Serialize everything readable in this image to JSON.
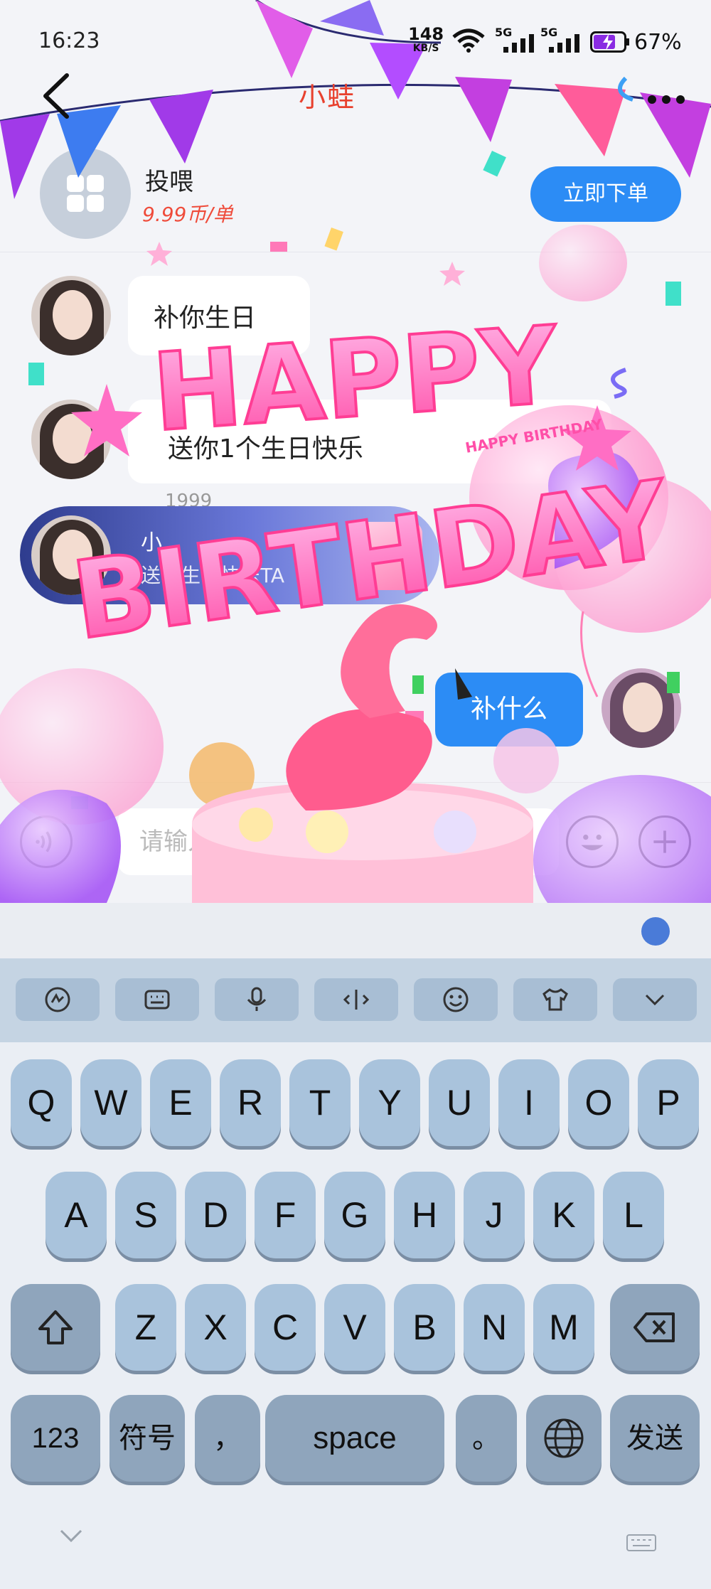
{
  "status_bar": {
    "time": "16:23",
    "net_speed": "148",
    "net_speed_unit": "KB/S",
    "signal_1": "5G",
    "signal_2": "5G",
    "battery": "67%"
  },
  "header": {
    "title": "小蛙",
    "back_icon": "chevron-left-icon",
    "more_icon": "more-dots-icon"
  },
  "service": {
    "name": "投喂",
    "price": "9.99币/单",
    "order_button": "立即下单"
  },
  "messages": [
    {
      "side": "left",
      "text": "补你生日"
    },
    {
      "side": "left",
      "text": "送你1个生日快乐",
      "sub": "1999"
    },
    {
      "side": "left",
      "type": "gift",
      "title": "小",
      "subtitle": "送你生日快乐TA"
    },
    {
      "side": "right",
      "text": "补什么"
    }
  ],
  "overlay": {
    "line1": "HAPPY",
    "line2": "BIRTHDAY",
    "cake_tag": "HAPPY BIRTHDAY"
  },
  "input": {
    "placeholder": "请输入"
  },
  "keyboard": {
    "toolbar": [
      "handwrite-icon",
      "keyboard-icon",
      "microphone-icon",
      "cursor-icon",
      "emoji-icon",
      "shirt-icon",
      "collapse-icon"
    ],
    "row1": [
      "Q",
      "W",
      "E",
      "R",
      "T",
      "Y",
      "U",
      "I",
      "O",
      "P"
    ],
    "row2": [
      "A",
      "S",
      "D",
      "F",
      "G",
      "H",
      "J",
      "K",
      "L"
    ],
    "row3": [
      "Z",
      "X",
      "C",
      "V",
      "B",
      "N",
      "M"
    ],
    "row4": {
      "num": "123",
      "symbols": "符号",
      "comma": "，",
      "space": "space",
      "period": "。",
      "send": "发送"
    }
  },
  "colors": {
    "accent": "#2c8cf5",
    "price": "#ef4b3a",
    "title": "#e8412e",
    "key": "#a9c3dc",
    "key_dark": "#8fa5bc"
  }
}
